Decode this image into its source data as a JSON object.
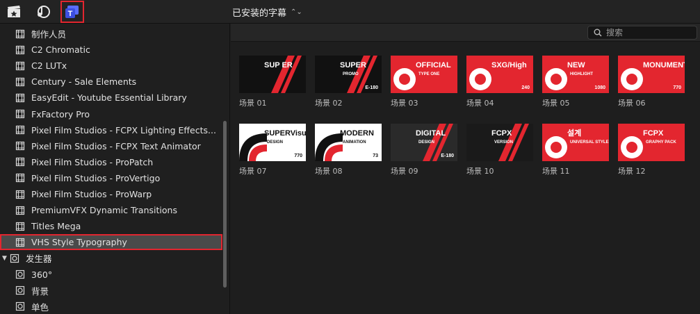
{
  "toolbar": {
    "icons": [
      {
        "name": "clapper-star-icon"
      },
      {
        "name": "music-photo-icon"
      },
      {
        "name": "titles-icon"
      }
    ],
    "browser_title": "已安装的字幕",
    "title_chevron": "⌃"
  },
  "search": {
    "placeholder": "搜索"
  },
  "sidebar": {
    "items": [
      {
        "label": "制作人员"
      },
      {
        "label": "C2 Chromatic"
      },
      {
        "label": "C2 LUTx"
      },
      {
        "label": "Century - Sale Elements"
      },
      {
        "label": "EasyEdit - Youtube Essential Library"
      },
      {
        "label": "FxFactory Pro"
      },
      {
        "label": "Pixel Film Studios - FCPX Lighting Effects..."
      },
      {
        "label": "Pixel Film Studios - FCPX Text Animator"
      },
      {
        "label": "Pixel Film Studios - ProPatch"
      },
      {
        "label": "Pixel Film Studios - ProVertigo"
      },
      {
        "label": "Pixel Film Studios - ProWarp"
      },
      {
        "label": "PremiumVFX Dynamic Transitions"
      },
      {
        "label": "Titles Mega"
      },
      {
        "label": "VHS Style Typography"
      }
    ],
    "group": {
      "label": "发生器"
    },
    "group_items": [
      {
        "label": "360°"
      },
      {
        "label": "背景"
      },
      {
        "label": "单色"
      }
    ]
  },
  "tiles": [
    {
      "label": "场景 01",
      "bg": "#111111",
      "text": "SUP ER"
    },
    {
      "label": "场景 02",
      "bg": "#111111",
      "text": "SUPER",
      "sub": "PROMO",
      "tag": "E-180"
    },
    {
      "label": "场景 03",
      "bg": "#e3262f",
      "text": "OFFICIAL",
      "sub": "TYPE ONE"
    },
    {
      "label": "场景 04",
      "bg": "#e3262f",
      "text": "SXG/High",
      "tag": "240"
    },
    {
      "label": "场景 05",
      "bg": "#e3262f",
      "text": "NEW",
      "sub": "HIGHLIGHT",
      "tag": "1080"
    },
    {
      "label": "场景 06",
      "bg": "#e3262f",
      "text": "MONUMENT",
      "tag": "770"
    },
    {
      "label": "场景 07",
      "bg": "#ffffff",
      "text": "SUPERVisual",
      "sub": "DESIGN",
      "tag": "770"
    },
    {
      "label": "场景 08",
      "bg": "#ffffff",
      "text": "MODERN",
      "sub": "ANIMATION",
      "tag": "73"
    },
    {
      "label": "场景 09",
      "bg": "#2a2a2a",
      "text": "DIGITAL",
      "sub": "DESIGN",
      "tag": "E-180"
    },
    {
      "label": "场景 10",
      "bg": "#1a1a1a",
      "text": "FCPX",
      "sub": "VERSION"
    },
    {
      "label": "场景 11",
      "bg": "#e3262f",
      "text": "설계",
      "sub": "UNIVERSAL STYLE"
    },
    {
      "label": "场景 12",
      "bg": "#e3262f",
      "text": "FCPX",
      "sub": "GRAPHY PACK"
    }
  ],
  "colors": {
    "accent": "#e3262f",
    "selection": "#4a4a4a"
  }
}
